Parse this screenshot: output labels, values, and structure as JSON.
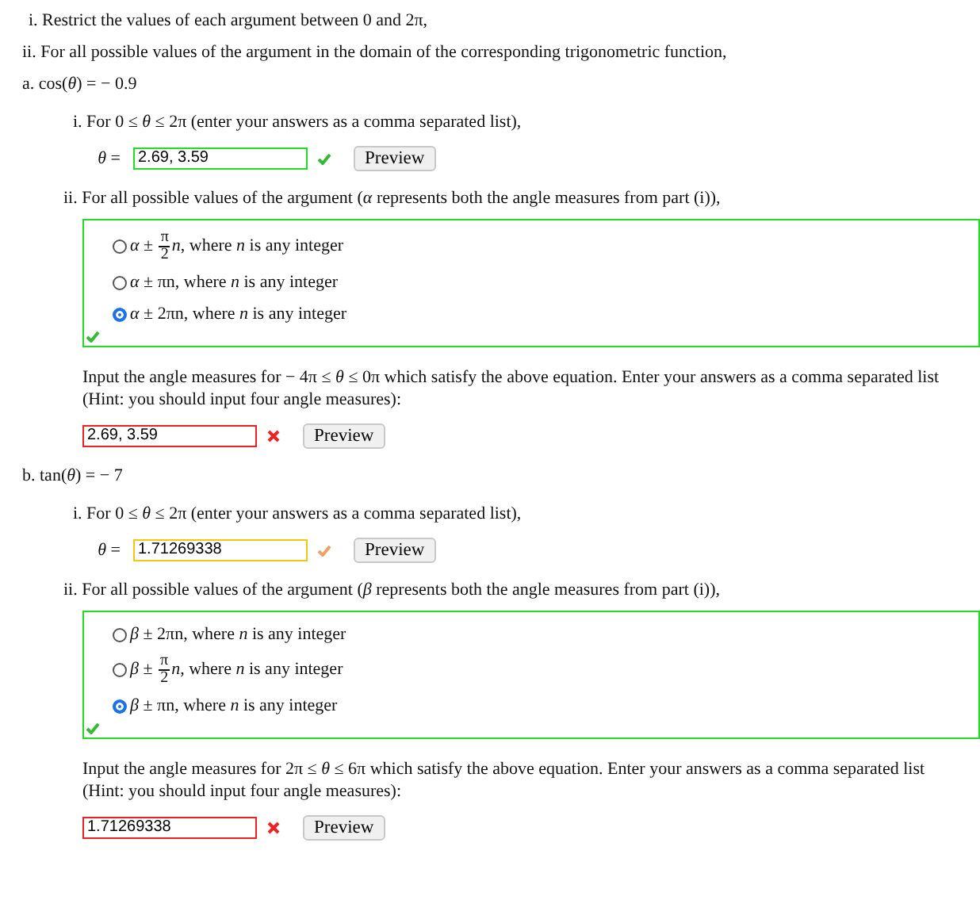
{
  "instructions": [
    "i. Restrict the values of each argument between 0 and 2π,",
    "ii. For all possible values of the argument in the domain of the corresponding trigonometric function,"
  ],
  "parts": [
    {
      "heading": "a. cos(*θ*) = − 0.9",
      "interval": {
        "prompt": "i. For 0 ≤ *θ* ≤ 2π (enter your answers as a comma separated list),",
        "variable": "*θ* =",
        "answer": {
          "value": "2.69, 3.59",
          "kind": "correct"
        },
        "button": "Preview"
      },
      "general": {
        "prompt": "ii. For all possible values of the argument (*α* represents both the angle measures from part (i)),",
        "correct": true,
        "choices": [
          {
            "before": "*α* ± ",
            "fraction": {
              "numerator": "π",
              "denominator": "2"
            },
            "after": "*n*, where *n* is any integer",
            "selected": false
          },
          {
            "before": "*α* ± πn, where *n* is any integer",
            "selected": false
          },
          {
            "before": "*α* ± 2πn, where *n* is any integer",
            "selected": true
          }
        ],
        "followup": "Input the angle measures for − 4π ≤ *θ* ≤ 0π which satisfy the above equation. Enter your answers as a comma separated list (Hint: you should input four angle measures):",
        "answer": {
          "value": "2.69, 3.59",
          "kind": "incorrect"
        },
        "button": "Preview"
      }
    },
    {
      "heading": "b. tan(*θ*) = − 7",
      "interval": {
        "prompt": "i. For 0 ≤ *θ* ≤ 2π (enter your answers as a comma separated list),",
        "variable": "*θ* =",
        "answer": {
          "value": "1.71269338",
          "kind": "partial"
        },
        "button": "Preview"
      },
      "general": {
        "prompt": "ii. For all possible values of the argument (*β* represents both the angle measures from part (i)),",
        "correct": true,
        "choices": [
          {
            "before": "*β* ± 2πn, where *n* is any integer",
            "selected": false
          },
          {
            "before": "*β* ± ",
            "fraction": {
              "numerator": "π",
              "denominator": "2"
            },
            "after": "*n*, where *n* is any integer",
            "selected": false
          },
          {
            "before": "*β* ± πn, where *n* is any integer",
            "selected": true
          }
        ],
        "followup": "Input the angle measures for 2π ≤ *θ* ≤ 6π which satisfy the above equation. Enter your answers as a comma separated list (Hint: you should input four angle measures):",
        "answer": {
          "value": "1.71269338",
          "kind": "incorrect"
        },
        "button": "Preview"
      }
    }
  ]
}
